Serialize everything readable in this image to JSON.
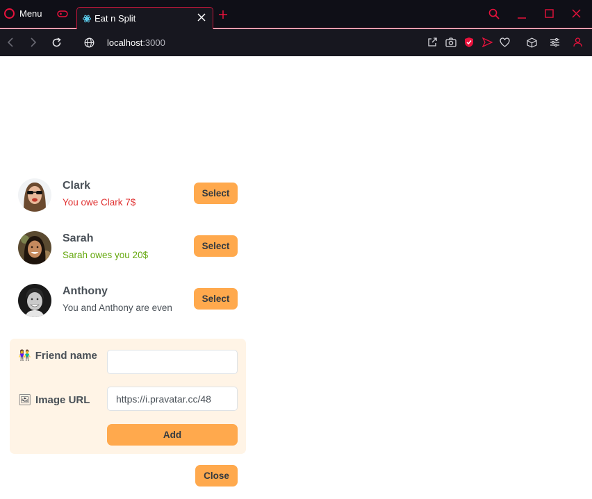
{
  "browser": {
    "menu_label": "Menu",
    "tab_title": "Eat n Split",
    "url_host": "localhost",
    "url_port": ":3000",
    "accent_color": "#e8123c"
  },
  "friends": [
    {
      "name": "Clark",
      "balance_text": "You owe Clark 7$",
      "status": "owe",
      "button": "Select"
    },
    {
      "name": "Sarah",
      "balance_text": "Sarah owes you 20$",
      "status": "owed",
      "button": "Select"
    },
    {
      "name": "Anthony",
      "balance_text": "You and Anthony are even",
      "status": "even",
      "button": "Select"
    }
  ],
  "add_form": {
    "name_emoji": "👫",
    "name_label": "Friend name",
    "name_value": "",
    "image_emoji": "🖼",
    "image_label": "Image URL",
    "image_value": "https://i.pravatar.cc/48",
    "add_label": "Add"
  },
  "close_label": "Close",
  "colors": {
    "button": "#ffa94d",
    "form_bg": "#fff4e6",
    "owe": "#e03131",
    "owed": "#66a80f"
  }
}
